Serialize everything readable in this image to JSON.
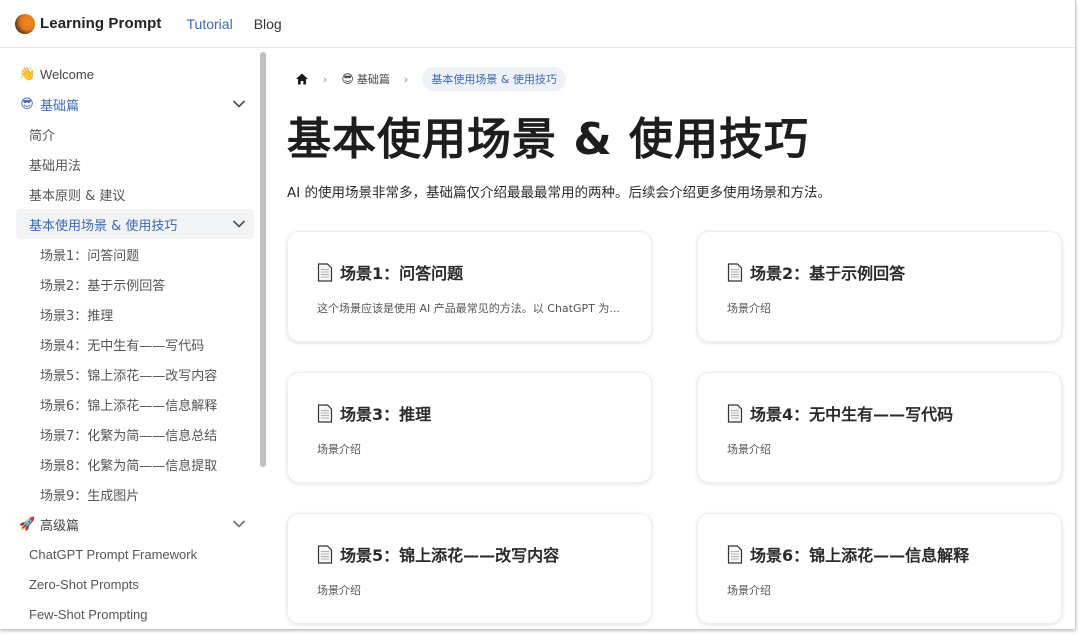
{
  "header": {
    "brand": "Learning Prompt",
    "nav": [
      {
        "label": "Tutorial",
        "active": true
      },
      {
        "label": "Blog",
        "active": false
      }
    ]
  },
  "sidebar": {
    "welcome": {
      "icon": "👋",
      "label": "Welcome"
    },
    "basics": {
      "icon": "😎",
      "label": "基础篇",
      "expanded": true,
      "items": [
        {
          "label": "简介"
        },
        {
          "label": "基础用法"
        },
        {
          "label": "基本原则 & 建议"
        }
      ],
      "active_group": {
        "label": "基本使用场景 & 使用技巧",
        "expanded": true,
        "children": [
          {
            "label": "场景1：问答问题"
          },
          {
            "label": "场景2：基于示例回答"
          },
          {
            "label": "场景3：推理"
          },
          {
            "label": "场景4：无中生有——写代码"
          },
          {
            "label": "场景5：锦上添花——改写内容"
          },
          {
            "label": "场景6：锦上添花——信息解释"
          },
          {
            "label": "场景7：化繁为简——信息总结"
          },
          {
            "label": "场景8：化繁为简——信息提取"
          },
          {
            "label": "场景9：生成图片"
          }
        ]
      }
    },
    "advanced": {
      "icon": "🚀",
      "label": "高级篇",
      "items": [
        {
          "label": "ChatGPT Prompt Framework"
        },
        {
          "label": "Zero-Shot Prompts"
        },
        {
          "label": "Few-Shot Prompting"
        }
      ]
    }
  },
  "breadcrumb": {
    "home_icon": "home-icon",
    "section": {
      "icon": "😎",
      "label": "基础篇"
    },
    "separator": "›",
    "current": "基本使用场景 & 使用技巧"
  },
  "main": {
    "title": "基本使用场景 & 使用技巧",
    "description": "AI 的使用场景非常多，基础篇仅介绍最最最常用的两种。后续会介绍更多使用场景和方法。",
    "cards": [
      {
        "title": "场景1：问答问题",
        "desc": "这个场景应该是使用 AI 产品最常见的方法。以 ChatGPT 为..."
      },
      {
        "title": "场景2：基于示例回答",
        "desc": "场景介绍"
      },
      {
        "title": "场景3：推理",
        "desc": "场景介绍"
      },
      {
        "title": "场景4：无中生有——写代码",
        "desc": "场景介绍"
      },
      {
        "title": "场景5：锦上添花——改写内容",
        "desc": "场景介绍"
      },
      {
        "title": "场景6：锦上添花——信息解释",
        "desc": "场景介绍"
      }
    ]
  },
  "colors": {
    "accent": "#3b6ab6",
    "active_bg": "#f2f3f5",
    "crumb_bg": "#eef1f6",
    "text": "#1d1d1d"
  }
}
